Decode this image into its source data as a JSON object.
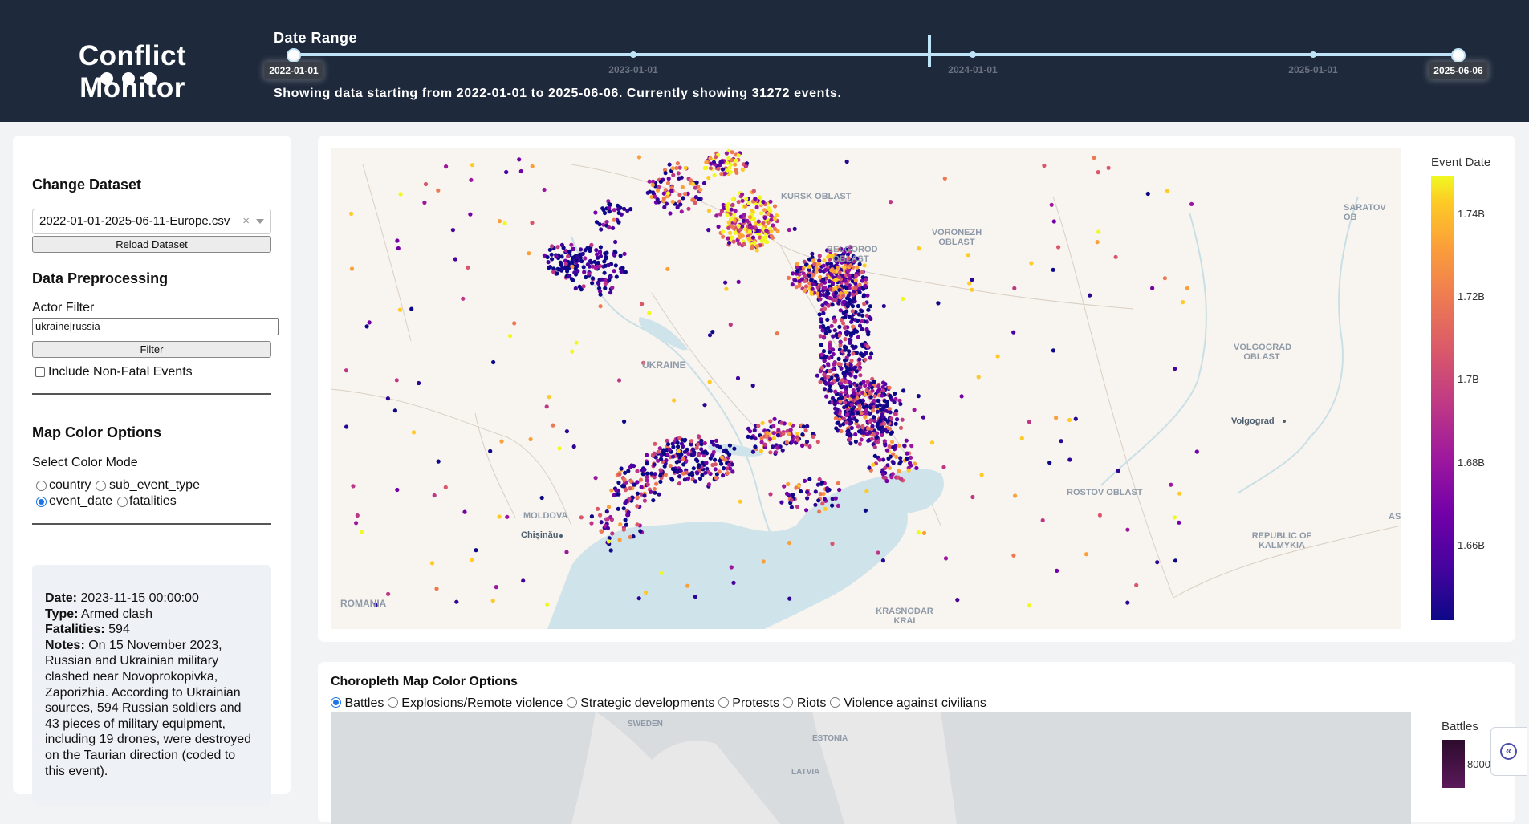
{
  "app": {
    "title": "Conflict Monitor"
  },
  "date_range": {
    "label": "Date Range",
    "start": "2022-01-01",
    "end": "2025-06-06",
    "ticks": [
      "2023-01-01",
      "2024-01-01",
      "2025-01-01"
    ],
    "summary": "Showing data starting from 2022-01-01 to 2025-06-06. Currently showing 31272 events."
  },
  "sidebar": {
    "change_dataset_heading": "Change Dataset",
    "dataset_value": "2022-01-01-2025-06-11-Europe.csv",
    "clear_symbol": "×",
    "reload_button": "Reload Dataset",
    "preprocessing_heading": "Data Preprocessing",
    "actor_filter_label": "Actor Filter",
    "actor_filter_value": "ukraine|russia",
    "filter_button": "Filter",
    "non_fatal_label": "Include Non-Fatal Events",
    "non_fatal_checked": false,
    "color_options_heading": "Map Color Options",
    "color_mode_label": "Select Color Mode",
    "color_modes": [
      "country",
      "sub_event_type",
      "event_date",
      "fatalities"
    ],
    "selected_color_mode": "event_date"
  },
  "event_detail": {
    "date_label": "Date:",
    "date": "2023-11-15 00:00:00",
    "type_label": "Type:",
    "type": "Armed clash",
    "fatalities_label": "Fatalities:",
    "fatalities": "594",
    "notes_label": "Notes:",
    "notes": "On 15 November 2023, Russian and Ukrainian military clashed near Novoprokopivka, Zaporizhia. According to Ukrainian sources, 594 Russian soldiers and 43 pieces of military equipment, including 19 drones, were destroyed on the Taurian direction (coded to this event)."
  },
  "map": {
    "labels": {
      "ukraine": "UKRAINE",
      "kursk": "KURSK OBLAST",
      "voronezh_1": "VORONEZH",
      "voronezh_2": "OBLAST",
      "belgorod_1": "BELGOROD",
      "belgorod_2": "OBLAST",
      "saratov": "SARATOV OB",
      "volgograd_1": "VOLGOGRAD",
      "volgograd_2": "OBLAST",
      "volgograd_city": "Volgograd",
      "rostov": "ROSTOV OBLAST",
      "moldova": "MOLDOVA",
      "chisinau": "Chișinău",
      "romania": "ROMANIA",
      "krasnodar_1": "KRASNODAR",
      "krasnodar_2": "KRAI",
      "kalmykia_1": "REPUBLIC OF",
      "kalmykia_2": "KALMYKIA",
      "as": "AS"
    },
    "colorbar": {
      "title": "Event Date",
      "ticks": [
        "1.74B",
        "1.72B",
        "1.7B",
        "1.68B",
        "1.66B"
      ]
    },
    "colors": {
      "early": "#0d0887",
      "mid": "#9c179e",
      "late": "#ed7953",
      "latest": "#f0f921",
      "water": "#cfe3ea",
      "land": "#f8f4ef"
    }
  },
  "choropleth": {
    "title": "Choropleth Map Color Options",
    "options": [
      "Battles",
      "Explosions/Remote violence",
      "Strategic developments",
      "Protests",
      "Riots",
      "Violence against civilians"
    ],
    "selected": "Battles",
    "map_labels": {
      "sweden": "SWEDEN",
      "estonia": "ESTONIA",
      "latvia": "LATVIA"
    },
    "colorbar_title": "Battles",
    "colorbar_tick": "8000"
  },
  "collapse_button": {
    "icon": "«"
  }
}
